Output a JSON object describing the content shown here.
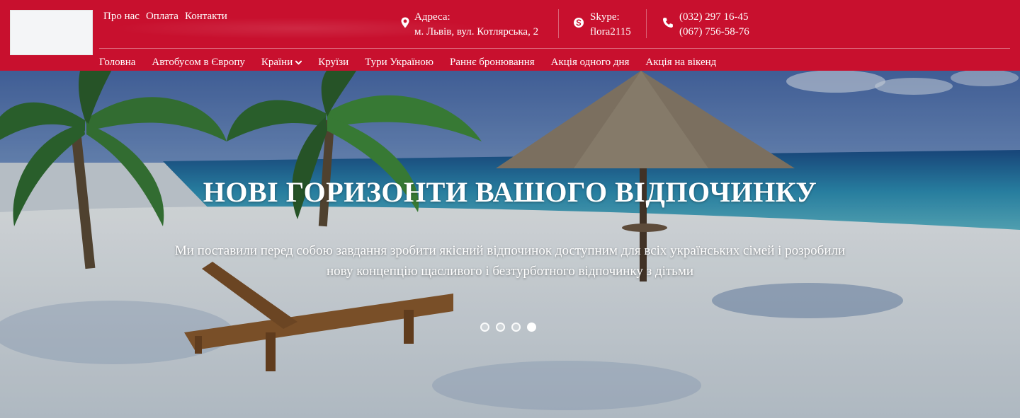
{
  "header": {
    "top_links": [
      "Про нас",
      "Оплата",
      "Контакти"
    ],
    "address": {
      "label": "Адреса:",
      "value": "м. Львів, вул. Котлярська, 2"
    },
    "skype": {
      "label": "Skype:",
      "value": "flora2115"
    },
    "phones": [
      "(032) 297 16-45",
      "(067) 756-58-76"
    ],
    "nav": [
      "Головна",
      "Автобусом в Європу",
      "Країни",
      "Круїзи",
      "Тури Україною",
      "Раннє бронювання",
      "Акція одного дня",
      "Акція на вікенд"
    ],
    "icons": {
      "address": "map-pin-icon",
      "skype": "skype-icon",
      "phone": "phone-icon",
      "dropdown": "chevron-down-icon"
    },
    "colors": {
      "brand_red": "#c8102e"
    }
  },
  "hero": {
    "title": "НОВІ ГОРИЗОНТИ ВАШОГО ВІДПОЧИНКУ",
    "subtitle": "Ми поставили перед собою завдання зробити якісний відпочинок доступним для всіх українських сімей і розробили нову концепцію щасливого і безтурботного відпочинку з дітьми",
    "slides_total": 4,
    "active_slide": 4
  }
}
